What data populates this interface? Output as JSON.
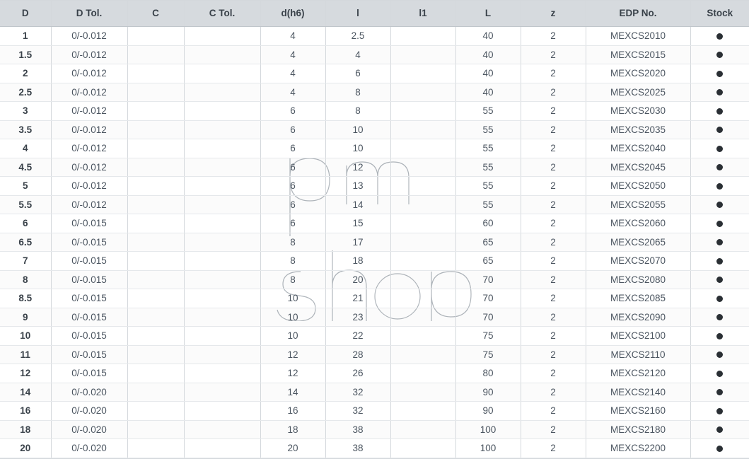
{
  "headers": [
    "D",
    "D Tol.",
    "C",
    "C Tol.",
    "d(h6)",
    "l",
    "l1",
    "L",
    "z",
    "EDP No.",
    "Stock"
  ],
  "rows": [
    {
      "D": "1",
      "DTol": "0/-0.012",
      "C": "",
      "CTol": "",
      "dh6": "4",
      "l": "2.5",
      "l1": "",
      "L": "40",
      "z": "2",
      "EDP": "MEXCS2010",
      "Stock": true
    },
    {
      "D": "1.5",
      "DTol": "0/-0.012",
      "C": "",
      "CTol": "",
      "dh6": "4",
      "l": "4",
      "l1": "",
      "L": "40",
      "z": "2",
      "EDP": "MEXCS2015",
      "Stock": true
    },
    {
      "D": "2",
      "DTol": "0/-0.012",
      "C": "",
      "CTol": "",
      "dh6": "4",
      "l": "6",
      "l1": "",
      "L": "40",
      "z": "2",
      "EDP": "MEXCS2020",
      "Stock": true
    },
    {
      "D": "2.5",
      "DTol": "0/-0.012",
      "C": "",
      "CTol": "",
      "dh6": "4",
      "l": "8",
      "l1": "",
      "L": "40",
      "z": "2",
      "EDP": "MEXCS2025",
      "Stock": true
    },
    {
      "D": "3",
      "DTol": "0/-0.012",
      "C": "",
      "CTol": "",
      "dh6": "6",
      "l": "8",
      "l1": "",
      "L": "55",
      "z": "2",
      "EDP": "MEXCS2030",
      "Stock": true
    },
    {
      "D": "3.5",
      "DTol": "0/-0.012",
      "C": "",
      "CTol": "",
      "dh6": "6",
      "l": "10",
      "l1": "",
      "L": "55",
      "z": "2",
      "EDP": "MEXCS2035",
      "Stock": true
    },
    {
      "D": "4",
      "DTol": "0/-0.012",
      "C": "",
      "CTol": "",
      "dh6": "6",
      "l": "10",
      "l1": "",
      "L": "55",
      "z": "2",
      "EDP": "MEXCS2040",
      "Stock": true
    },
    {
      "D": "4.5",
      "DTol": "0/-0.012",
      "C": "",
      "CTol": "",
      "dh6": "6",
      "l": "12",
      "l1": "",
      "L": "55",
      "z": "2",
      "EDP": "MEXCS2045",
      "Stock": true
    },
    {
      "D": "5",
      "DTol": "0/-0.012",
      "C": "",
      "CTol": "",
      "dh6": "6",
      "l": "13",
      "l1": "",
      "L": "55",
      "z": "2",
      "EDP": "MEXCS2050",
      "Stock": true
    },
    {
      "D": "5.5",
      "DTol": "0/-0.012",
      "C": "",
      "CTol": "",
      "dh6": "6",
      "l": "14",
      "l1": "",
      "L": "55",
      "z": "2",
      "EDP": "MEXCS2055",
      "Stock": true
    },
    {
      "D": "6",
      "DTol": "0/-0.015",
      "C": "",
      "CTol": "",
      "dh6": "6",
      "l": "15",
      "l1": "",
      "L": "60",
      "z": "2",
      "EDP": "MEXCS2060",
      "Stock": true
    },
    {
      "D": "6.5",
      "DTol": "0/-0.015",
      "C": "",
      "CTol": "",
      "dh6": "8",
      "l": "17",
      "l1": "",
      "L": "65",
      "z": "2",
      "EDP": "MEXCS2065",
      "Stock": true
    },
    {
      "D": "7",
      "DTol": "0/-0.015",
      "C": "",
      "CTol": "",
      "dh6": "8",
      "l": "18",
      "l1": "",
      "L": "65",
      "z": "2",
      "EDP": "MEXCS2070",
      "Stock": true
    },
    {
      "D": "8",
      "DTol": "0/-0.015",
      "C": "",
      "CTol": "",
      "dh6": "8",
      "l": "20",
      "l1": "",
      "L": "70",
      "z": "2",
      "EDP": "MEXCS2080",
      "Stock": true
    },
    {
      "D": "8.5",
      "DTol": "0/-0.015",
      "C": "",
      "CTol": "",
      "dh6": "10",
      "l": "21",
      "l1": "",
      "L": "70",
      "z": "2",
      "EDP": "MEXCS2085",
      "Stock": true
    },
    {
      "D": "9",
      "DTol": "0/-0.015",
      "C": "",
      "CTol": "",
      "dh6": "10",
      "l": "23",
      "l1": "",
      "L": "70",
      "z": "2",
      "EDP": "MEXCS2090",
      "Stock": true
    },
    {
      "D": "10",
      "DTol": "0/-0.015",
      "C": "",
      "CTol": "",
      "dh6": "10",
      "l": "22",
      "l1": "",
      "L": "75",
      "z": "2",
      "EDP": "MEXCS2100",
      "Stock": true
    },
    {
      "D": "11",
      "DTol": "0/-0.015",
      "C": "",
      "CTol": "",
      "dh6": "12",
      "l": "28",
      "l1": "",
      "L": "75",
      "z": "2",
      "EDP": "MEXCS2110",
      "Stock": true
    },
    {
      "D": "12",
      "DTol": "0/-0.015",
      "C": "",
      "CTol": "",
      "dh6": "12",
      "l": "26",
      "l1": "",
      "L": "80",
      "z": "2",
      "EDP": "MEXCS2120",
      "Stock": true
    },
    {
      "D": "14",
      "DTol": "0/-0.020",
      "C": "",
      "CTol": "",
      "dh6": "14",
      "l": "32",
      "l1": "",
      "L": "90",
      "z": "2",
      "EDP": "MEXCS2140",
      "Stock": true
    },
    {
      "D": "16",
      "DTol": "0/-0.020",
      "C": "",
      "CTol": "",
      "dh6": "16",
      "l": "32",
      "l1": "",
      "L": "90",
      "z": "2",
      "EDP": "MEXCS2160",
      "Stock": true
    },
    {
      "D": "18",
      "DTol": "0/-0.020",
      "C": "",
      "CTol": "",
      "dh6": "18",
      "l": "38",
      "l1": "",
      "L": "100",
      "z": "2",
      "EDP": "MEXCS2180",
      "Stock": true
    },
    {
      "D": "20",
      "DTol": "0/-0.020",
      "C": "",
      "CTol": "",
      "dh6": "20",
      "l": "38",
      "l1": "",
      "L": "100",
      "z": "2",
      "EDP": "MEXCS2200",
      "Stock": true
    }
  ],
  "watermark_top": "pm",
  "watermark_bot": "shop"
}
